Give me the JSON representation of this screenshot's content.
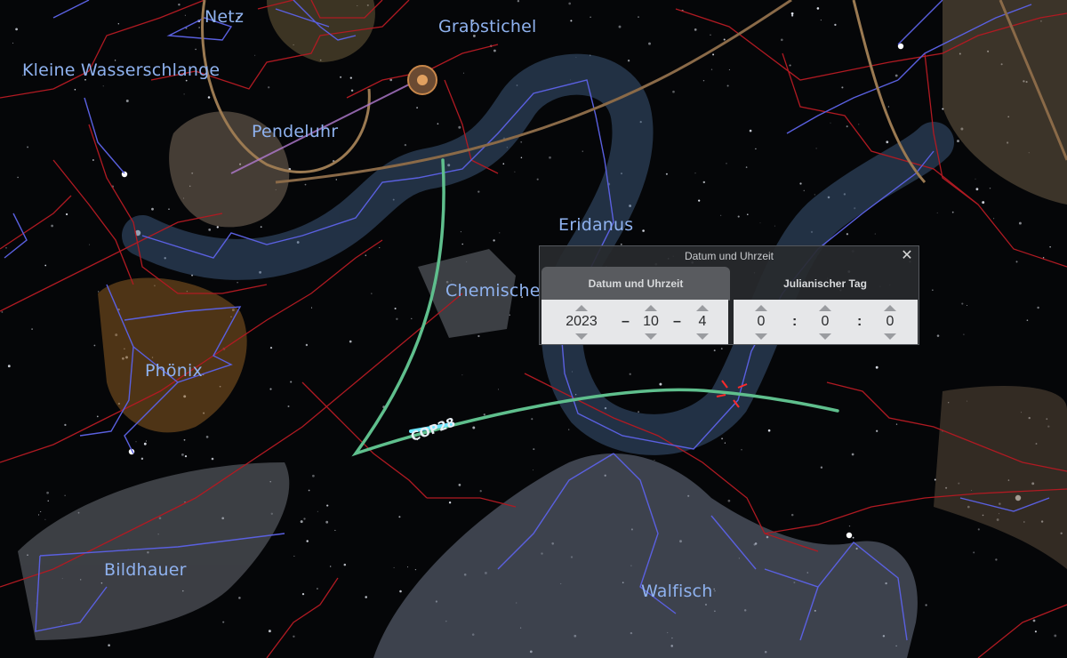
{
  "constellations": {
    "netz": "Netz",
    "grabstichel": "Grabstichel",
    "kleine_wasserschlange": "Kleine Wasserschlange",
    "pendeluhr": "Pendeluhr",
    "eridanus": "Eridanus",
    "chemischer_ofen": "Chemischer Ofen",
    "phonix": "Phönix",
    "bildhauer": "Bildhauer",
    "walfisch": "Walfisch"
  },
  "object_label": "COP28",
  "dialog": {
    "title": "Datum und Uhrzeit",
    "close": "✕",
    "tab_date": "Datum und Uhrzeit",
    "tab_jd": "Julianischer Tag",
    "year": "2023",
    "month": "10",
    "day": "4",
    "hour": "0",
    "minute": "0",
    "second": "0",
    "date_sep": "–",
    "time_sep": ":"
  },
  "colors": {
    "boundary": "#b01a22",
    "lines": "#5a60e0",
    "ecliptic": "#9b7a52",
    "orbit": "#5fbf8d",
    "label": "#8fb2ef"
  }
}
